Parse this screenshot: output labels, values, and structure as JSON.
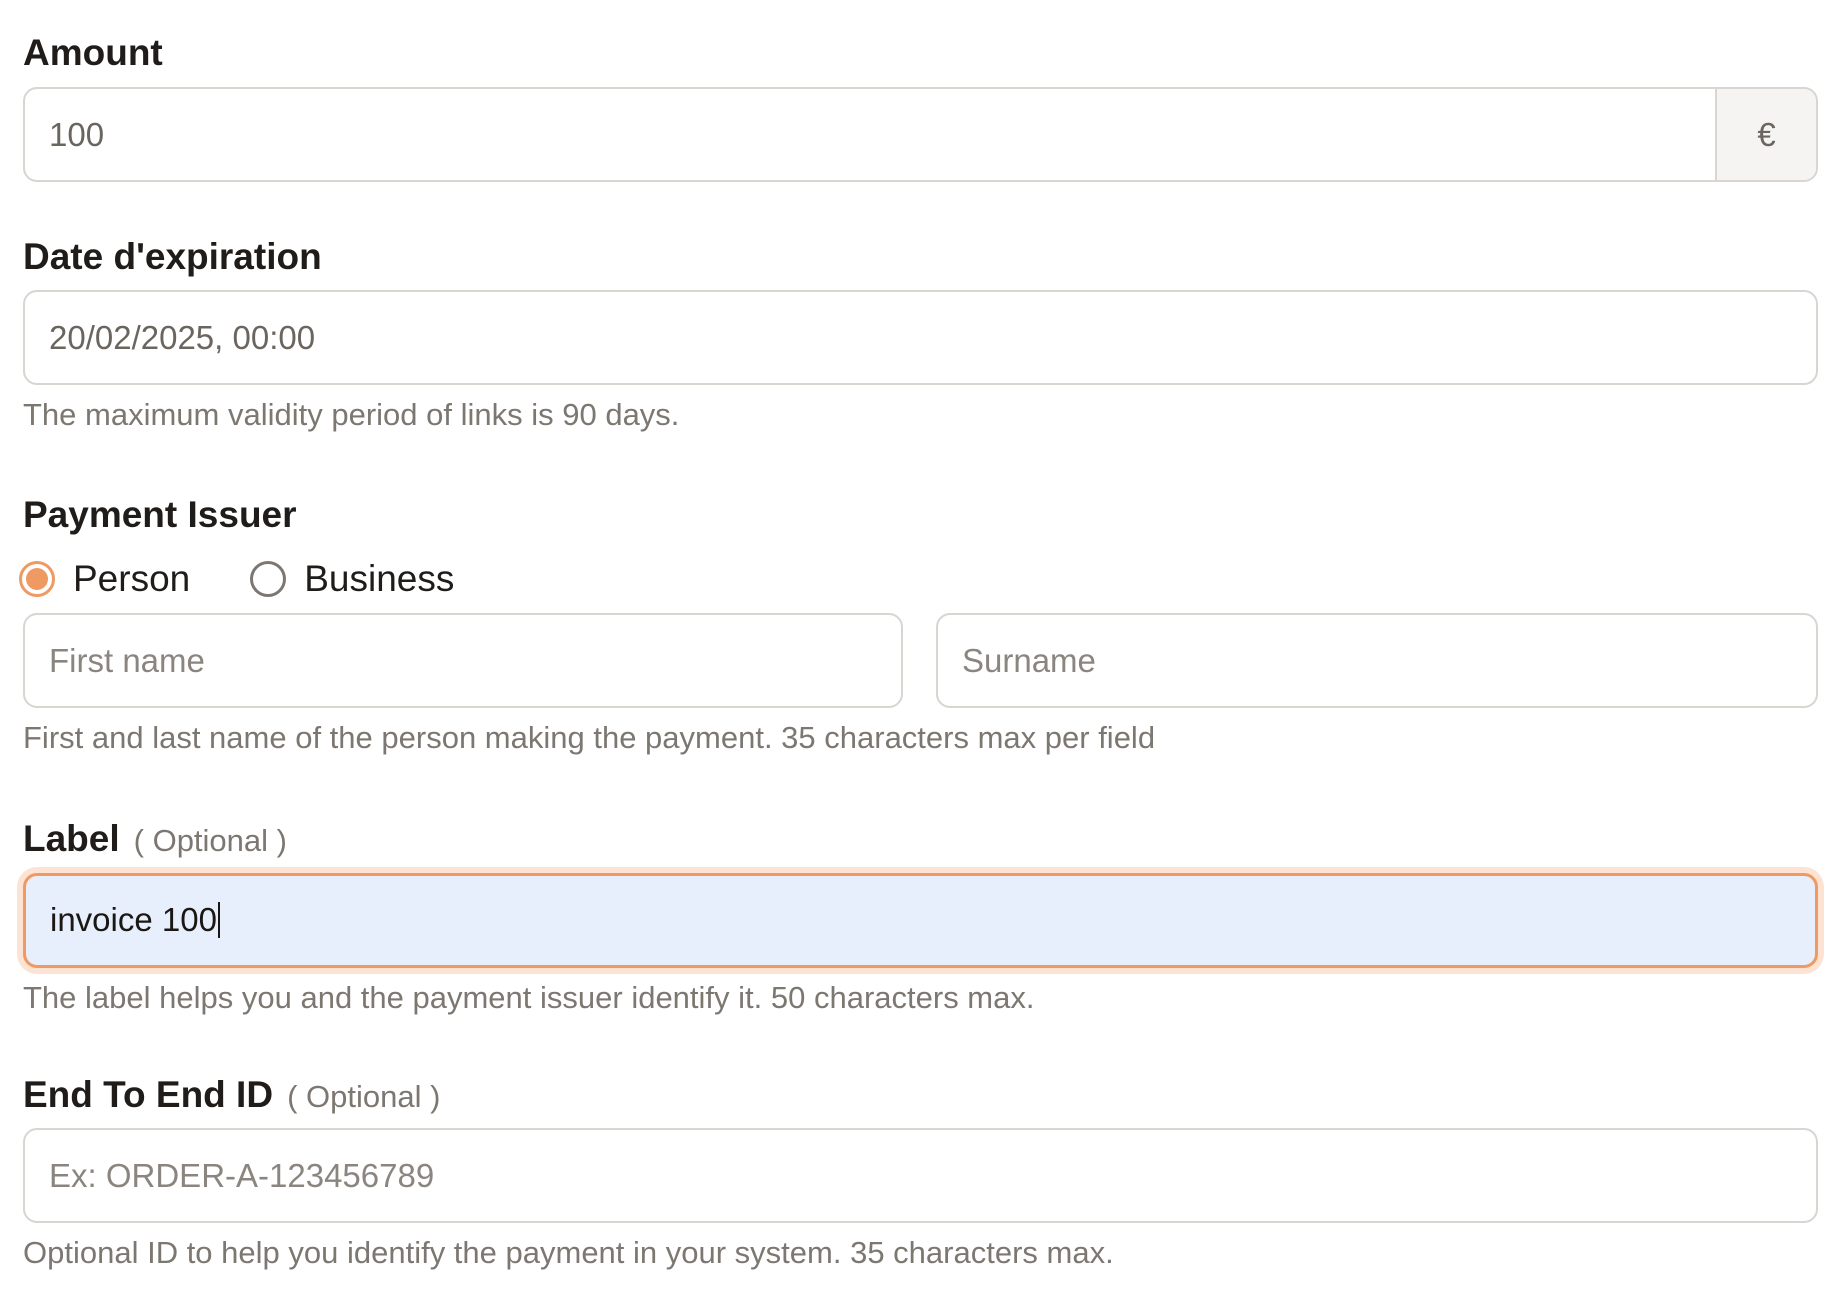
{
  "amount": {
    "label": "Amount",
    "value": "100",
    "currency_symbol": "€"
  },
  "expiration": {
    "label": "Date d'expiration",
    "value": "20/02/2025, 00:00",
    "help": "The maximum validity period of links is 90 days."
  },
  "payment_issuer": {
    "label": "Payment Issuer",
    "options": [
      {
        "label": "Person",
        "checked": true
      },
      {
        "label": "Business",
        "checked": false
      }
    ],
    "first_name_placeholder": "First name",
    "surname_placeholder": "Surname",
    "help": "First and last name of the person making the payment. 35 characters max per field"
  },
  "label_field": {
    "label": "Label",
    "optional": "( Optional )",
    "value": "invoice 100",
    "help": "The label helps you and the payment issuer identify it. 50 characters max."
  },
  "end_to_end": {
    "label": "End To End ID",
    "optional": "( Optional )",
    "placeholder": "Ex: ORDER-A-123456789",
    "help": "Optional ID to help you identify the payment in your system. 35 characters max."
  },
  "colors": {
    "accent": "#ee9a62",
    "focus_background": "#e8effc",
    "border": "#d9d5d1",
    "help_text": "#7d7771"
  }
}
